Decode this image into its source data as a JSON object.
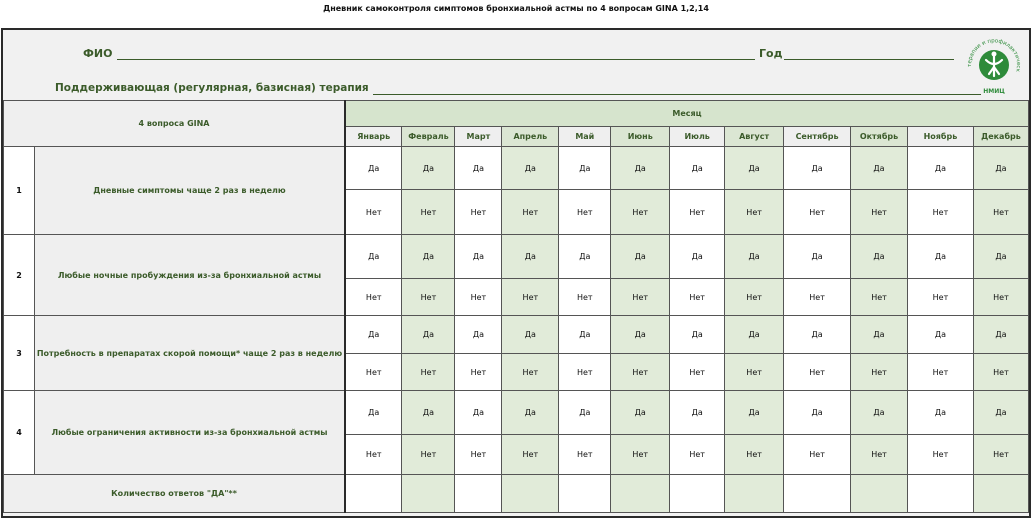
{
  "doc_title": "Дневник самоконтроля симптомов бронхиальной астмы по 4 вопросам GINA 1,2,14",
  "header": {
    "fio_label": "ФИО",
    "god_label": "Год",
    "therapy_label": "Поддерживающая (регулярная, базисная) терапия"
  },
  "logo": {
    "text": "НМИЦ терапии и профилактической медицины",
    "short": "НМИЦ",
    "color": "#2e8b3a"
  },
  "table": {
    "questions_header": "4 вопроса GINA",
    "month_header": "Месяц",
    "months": [
      "Январь",
      "Февраль",
      "Март",
      "Апрель",
      "Май",
      "Июнь",
      "Июль",
      "Август",
      "Сентябрь",
      "Октябрь",
      "Ноябрь",
      "Декабрь"
    ],
    "yes": "Да",
    "no": "Нет",
    "questions": [
      {
        "num": "1",
        "text": "Дневные симптомы чаще 2 раз в неделю"
      },
      {
        "num": "2",
        "text": "Любые ночные пробуждения из-за бронхиальной астмы"
      },
      {
        "num": "3",
        "text": "Потребность в препаратах скорой помощи* чаще 2 раз в неделю"
      },
      {
        "num": "4",
        "text": "Любые ограничения активности из-за бронхиальной астмы"
      }
    ],
    "count_label": "Количество ответов \"ДА\"**"
  },
  "colors": {
    "accent_green": "#3b5b2a",
    "light_green": "#e1ebd9",
    "header_gray": "#efefef"
  }
}
